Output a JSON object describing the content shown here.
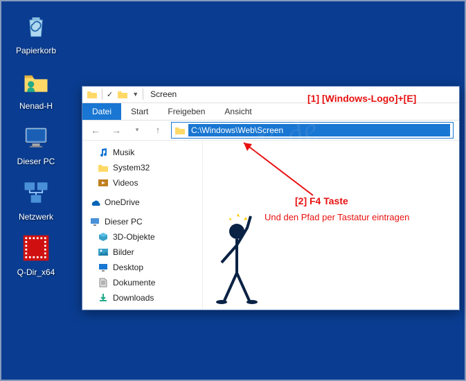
{
  "desktop": {
    "icons": [
      {
        "id": "papierkorb",
        "label": "Papierkorb",
        "icon": "recycle-bin"
      },
      {
        "id": "nenad",
        "label": "Nenad-H",
        "icon": "user-folder"
      },
      {
        "id": "pc",
        "label": "Dieser PC",
        "icon": "this-pc"
      },
      {
        "id": "netzwerk",
        "label": "Netzwerk",
        "icon": "network"
      },
      {
        "id": "qdir",
        "label": "Q-Dir_x64",
        "icon": "q-dir"
      }
    ]
  },
  "explorer": {
    "title": "Screen",
    "ribbon": {
      "file": "Datei",
      "tabs": [
        "Start",
        "Freigeben",
        "Ansicht"
      ]
    },
    "address": "C:\\Windows\\Web\\Screen",
    "tree": {
      "favorites": [
        {
          "label": "Musik",
          "icon": "music"
        },
        {
          "label": "System32",
          "icon": "folder"
        },
        {
          "label": "Videos",
          "icon": "videos"
        }
      ],
      "onedrive": {
        "label": "OneDrive",
        "icon": "onedrive"
      },
      "thispc": {
        "label": "Dieser PC",
        "children": [
          {
            "label": "3D-Objekte",
            "icon": "3d"
          },
          {
            "label": "Bilder",
            "icon": "pictures"
          },
          {
            "label": "Desktop",
            "icon": "desktop"
          },
          {
            "label": "Dokumente",
            "icon": "documents"
          },
          {
            "label": "Downloads",
            "icon": "downloads"
          }
        ]
      }
    }
  },
  "annotations": {
    "a1": "[1] [Windows-Logo]+[E]",
    "a2": "[2] F4 Taste",
    "a2b": "Und den Pfad per Tastatur eintragen"
  },
  "watermark": "SoftwareOK.de"
}
